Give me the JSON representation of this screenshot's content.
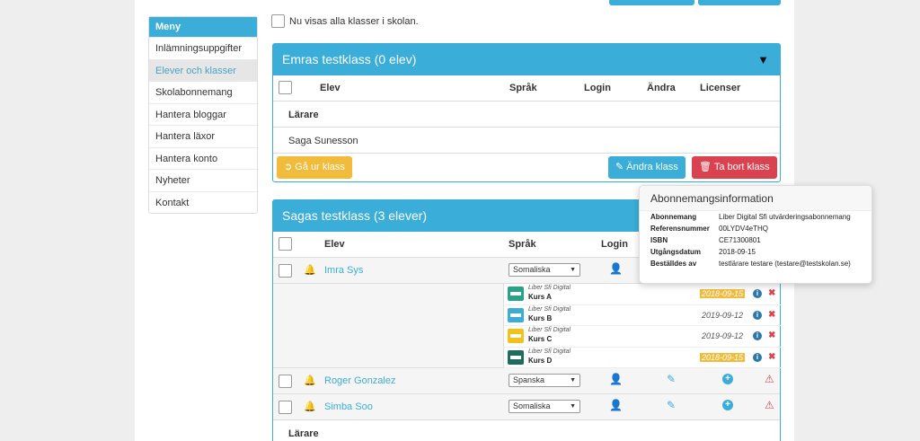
{
  "menu": {
    "heading": "Meny",
    "items": [
      {
        "label": "Inlämningsuppgifter"
      },
      {
        "label": "Elever och klasser"
      },
      {
        "label": "Skolabonnemang"
      },
      {
        "label": "Hantera bloggar"
      },
      {
        "label": "Hantera läxor"
      },
      {
        "label": "Hantera konto"
      },
      {
        "label": "Nyheter"
      },
      {
        "label": "Kontakt"
      }
    ],
    "active_index": 1
  },
  "notice": "Nu visas alla klasser i skolan.",
  "class1": {
    "title": "Emras testklass (0 elev)",
    "columns": {
      "student": "Elev",
      "language": "Språk",
      "login": "Login",
      "edit": "Ändra",
      "licenses": "Licenser"
    },
    "teachers_label": "Lärare",
    "teacher": "Saga Sunesson",
    "leave_button": "Gå ur klass",
    "edit_button": "Ändra klass",
    "delete_button": "Ta bort klass"
  },
  "class2": {
    "title": "Sagas testklass (3 elever)",
    "columns": {
      "student": "Elev",
      "language": "Språk",
      "login": "Login"
    },
    "students": [
      {
        "name": "Imra Sys",
        "language": "Somaliska"
      },
      {
        "name": "Roger Gonzalez",
        "language": "Spanska"
      },
      {
        "name": "Simba Soo",
        "language": "Somaliska"
      }
    ],
    "licenses": [
      {
        "publisher": "Liber Sfi Digital",
        "course": "Kurs A",
        "date": "2018-09-15",
        "expired": true,
        "color": "#27a38a"
      },
      {
        "publisher": "Liber Sfi Digital",
        "course": "Kurs B",
        "date": "2019-09-12",
        "expired": false,
        "color": "#3aaed8"
      },
      {
        "publisher": "Liber Sfi Digital",
        "course": "Kurs C",
        "date": "2019-09-12",
        "expired": false,
        "color": "#f1c21b"
      },
      {
        "publisher": "Liber Sfi Digital",
        "course": "Kurs D",
        "date": "2018-09-15",
        "expired": true,
        "color": "#1f6b5c"
      }
    ],
    "teachers_label": "Lärare"
  },
  "tooltip": {
    "title": "Abonnemangsinformation",
    "rows": [
      {
        "key": "Abonnemang",
        "value": "Liber Digital Sfi utvärderingsabonnemang"
      },
      {
        "key": "Referensnummer",
        "value": "00LYDV4eTHQ"
      },
      {
        "key": "ISBN",
        "value": "CE71300801"
      },
      {
        "key": "Utgångsdatum",
        "value": "2018-09-15"
      },
      {
        "key": "Beställdes av",
        "value": "testlärare testare (testare@testskolan.se)"
      }
    ]
  },
  "colors": {
    "accent": "#3aaed8",
    "warning": "#f1bb3b",
    "danger": "#d9424e"
  },
  "icons": {
    "bell": "bell-icon",
    "user": "user-icon",
    "edit": "pencil-icon",
    "add": "plus-circle-icon",
    "warn": "warning-triangle-icon",
    "info": "info-icon",
    "delete": "close-icon",
    "chevron": "chevron-down-icon"
  }
}
